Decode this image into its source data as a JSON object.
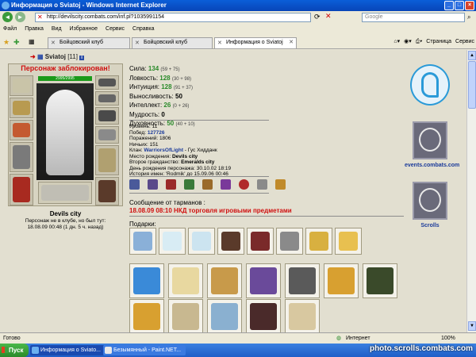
{
  "window": {
    "title": "Информация о Sviatoj - Windows Internet Explorer",
    "min": "_",
    "max": "□",
    "close": "×"
  },
  "address": {
    "url": "http://devilscity.combats.com/inf.pl?1035991154",
    "search_placeholder": "Google"
  },
  "menu": [
    "Файл",
    "Правка",
    "Вид",
    "Избранное",
    "Сервис",
    "Справка"
  ],
  "tabs": [
    {
      "label": "Бойцовский клуб",
      "active": false
    },
    {
      "label": "Бойцовский клуб",
      "active": false
    },
    {
      "label": "Информация о Sviatoj",
      "active": true
    }
  ],
  "toolbar_right": {
    "page": "Страница",
    "tools": "Сервис"
  },
  "character": {
    "name": "Sviatoj",
    "level": "[11]",
    "info_icon": "i",
    "blocked": "Персонаж заблокирован!",
    "hp": "2995/2995",
    "city": "Devils city",
    "location_note": "Персонаж не в клубе, но был тут:",
    "last_seen": "18.08.09 00:48 (1 дн. 5 ч. назад)"
  },
  "stats": [
    {
      "label": "Сила:",
      "value": "134",
      "extra": "(59 + 75)"
    },
    {
      "label": "Ловкость:",
      "value": "128",
      "extra": "(30 + 98)"
    },
    {
      "label": "Интуиция:",
      "value": "128",
      "extra": "(91 + 37)"
    },
    {
      "label": "Выносливость:",
      "value": "50",
      "extra": ""
    },
    {
      "label": "Интеллект:",
      "value": "26",
      "extra": "(0 + 26)"
    },
    {
      "label": "Мудрость:",
      "value": "0",
      "extra": ""
    },
    {
      "label": "Духовность:",
      "value": "50",
      "extra": "(40 + 10)"
    }
  ],
  "details": {
    "level": "Уровень: 11",
    "wins_label": "Побед: ",
    "wins": "127726",
    "losses": "Поражений: 1806",
    "draws": "Ничьих: 151",
    "clan_label": "Клан: ",
    "clan": "WarriorsOfLight",
    "clan_rank": " - Гус Хидданк",
    "birthplace_label": "Место рождения: ",
    "birthplace": "Devils city",
    "citizenship_label": "Второе гражданство: ",
    "citizenship": "Emeralds city",
    "birthday": "День рождения персонажа: 30.10.02 18:19",
    "name_history": "История имен: 'Rodmik' до 15.09.06 00:46"
  },
  "message": {
    "title": "Сообщение от тарманов :",
    "text": "18.08.09 08:10 НКД торговля игровыми предметами"
  },
  "gifts_label": "Подарки:",
  "right": {
    "events": "events.combats.com",
    "scrolls": "Scrolls"
  },
  "status": {
    "left": "Готово",
    "zone": "Интернет",
    "zoom": "100%"
  },
  "taskbar": {
    "start": "Пуск",
    "tasks": [
      "Информация о Sviato...",
      "Безымянный - Paint.NET..."
    ]
  },
  "watermark": "photo.scrolls.combats.com",
  "colors": {
    "blocked": "#d01010",
    "stat": "#2a8a2a",
    "link": "#1a3a9a"
  }
}
